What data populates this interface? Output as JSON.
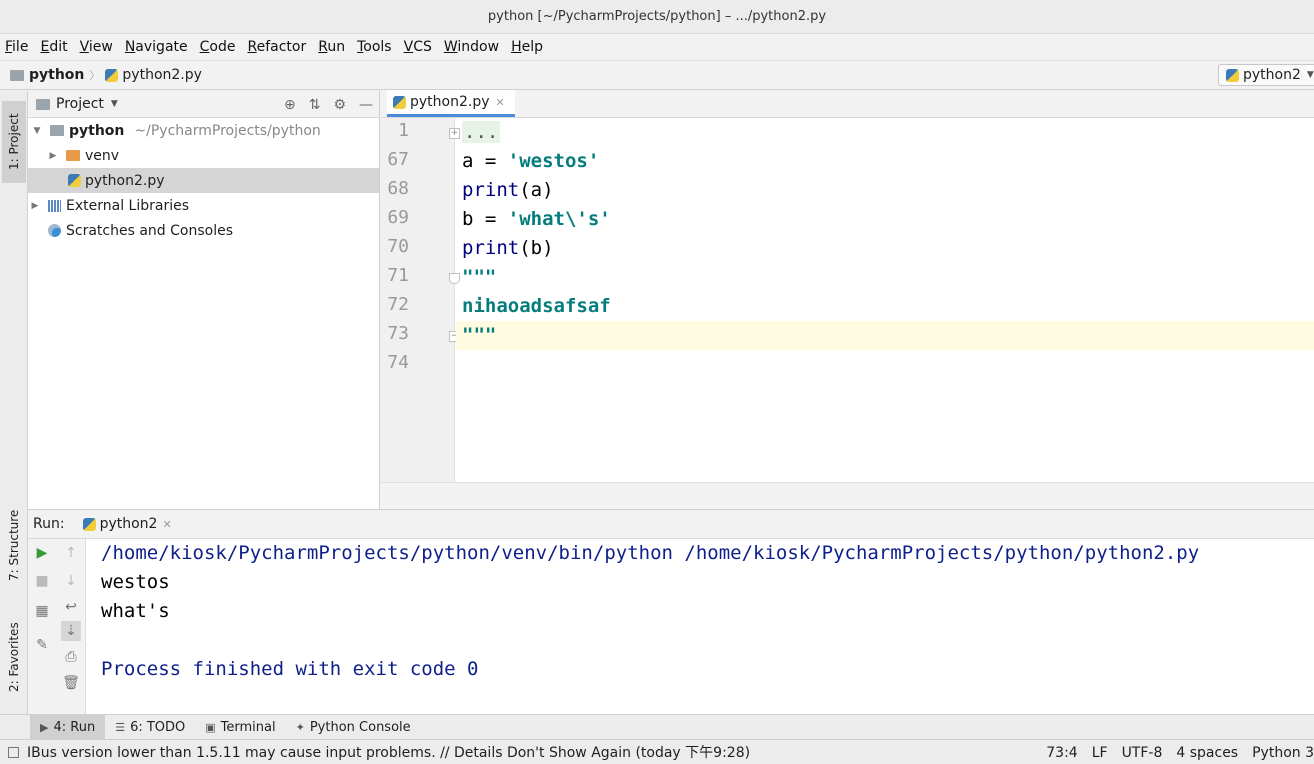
{
  "window": {
    "title": "python [~/PycharmProjects/python] – .../python2.py"
  },
  "menu": [
    "File",
    "Edit",
    "View",
    "Navigate",
    "Code",
    "Refactor",
    "Run",
    "Tools",
    "VCS",
    "Window",
    "Help"
  ],
  "navbar": {
    "crumb1": "python",
    "crumb2": "python2.py",
    "run_config": "python2"
  },
  "left_strip": {
    "project_tab": "1: Project",
    "structure_tab": "7: Structure",
    "favorites_tab": "2: Favorites"
  },
  "project": {
    "title": "Project",
    "root_name": "python",
    "root_path": "~/PycharmProjects/python",
    "items": [
      "venv",
      "python2.py",
      "External Libraries",
      "Scratches and Consoles"
    ]
  },
  "editor": {
    "tab": "python2.py",
    "line_numbers": [
      "1",
      "67",
      "68",
      "69",
      "70",
      "71",
      "72",
      "73",
      "74"
    ],
    "collapsed": "...",
    "code": {
      "l67_var": "a = ",
      "l67_str": "'westos'",
      "l68_kw": "print",
      "l68_rest": "(a)",
      "l69_var": "b = ",
      "l69_str": "'what\\'s'",
      "l70_kw": "print",
      "l70_rest": "(b)",
      "l71": "\"\"\"",
      "l72": "nihaoadsafsaf",
      "l73": "\"\"\""
    }
  },
  "run": {
    "label": "Run:",
    "tab": "python2",
    "output": [
      "/home/kiosk/PycharmProjects/python/venv/bin/python /home/kiosk/PycharmProjects/python/python2.py",
      "westos",
      "what's",
      "",
      "Process finished with exit code 0"
    ]
  },
  "bottom_tabs": [
    "4: Run",
    "6: TODO",
    "Terminal",
    "Python Console"
  ],
  "status": {
    "message": "IBus version lower than 1.5.11 may cause input problems. // Details   Don't Show Again (today 下午9:28)",
    "position": "73:4",
    "line_sep": "LF",
    "encoding": "UTF-8",
    "indent": "4 spaces",
    "interpreter": "Python 3"
  }
}
